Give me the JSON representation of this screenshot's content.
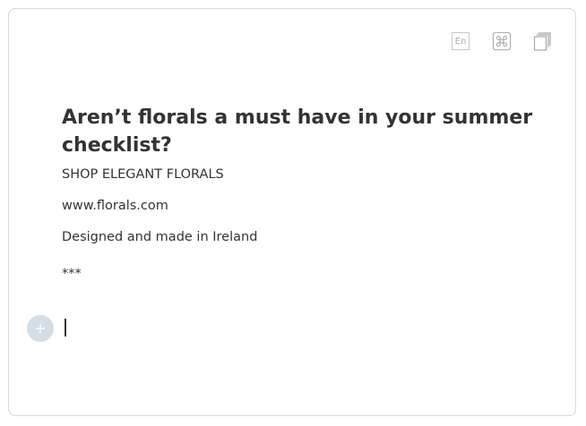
{
  "toolbar": {
    "language_label": "En",
    "icons": [
      "language-icon",
      "command-icon",
      "copy-icon"
    ]
  },
  "content": {
    "title": "Aren’t florals a must have in your summer checklist?",
    "lines": [
      "SHOP ELEGANT FLORALS",
      "www.florals.com",
      "Designed and made in Ireland",
      "***"
    ]
  },
  "editor": {
    "add_block_icon": "plus-icon",
    "cursor": "|"
  },
  "colors": {
    "text": "#333333",
    "border": "#d9d9d9",
    "icon": "#a8a8a8",
    "add_button": "#d3dee6"
  }
}
